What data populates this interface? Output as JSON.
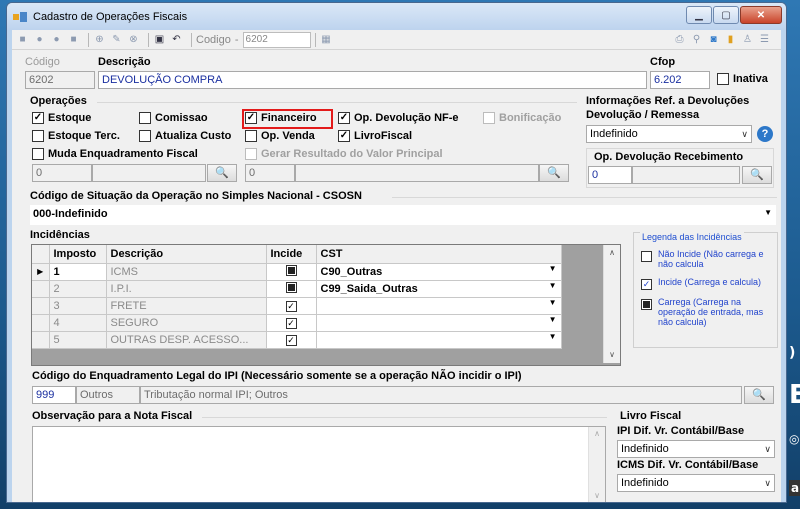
{
  "window": {
    "title": "Cadastro de Operações Fiscais"
  },
  "toolbar": {
    "codigo_label": "Codigo",
    "codigo_value": "6202"
  },
  "header": {
    "codigo_label": "Código",
    "codigo_value": "6202",
    "descricao_label": "Descrição",
    "descricao_value": "DEVOLUÇÃO COMPRA",
    "cfop_label": "Cfop",
    "cfop_value": "6.202",
    "inativa_label": "Inativa"
  },
  "operacoes": {
    "title": "Operações",
    "estoque": "Estoque",
    "comissao": "Comissao",
    "financeiro": "Financeiro",
    "op_devolucao_nfe": "Op. Devolução NF-e",
    "bonificacao": "Bonificação",
    "estoque_terc": "Estoque Terc.",
    "atualiza_custo": "Atualiza Custo",
    "op_venda": "Op. Venda",
    "livro_fiscal": "LivroFiscal",
    "muda_enquadramento": "Muda Enquadramento Fiscal",
    "gerar_resultado": "Gerar Resultado do Valor Principal",
    "muda_code": "0",
    "gerar_code": "0"
  },
  "ref_devolucoes": {
    "title1": "Informações Ref. a Devoluções",
    "title2": "Devolução / Remessa",
    "select_value": "Indefinido",
    "op_recebimento_label": "Op. Devolução Recebimento",
    "op_recebimento_value": "0"
  },
  "csosn": {
    "label": "Código de Situação da Operação no Simples Nacional - CSOSN",
    "value": "000-Indefinido"
  },
  "incidencias": {
    "title": "Incidências",
    "columns": [
      "Imposto",
      "Descrição",
      "Incide",
      "CST"
    ],
    "rows": [
      {
        "imposto": "1",
        "descricao": "ICMS",
        "cst": "C90_Outras"
      },
      {
        "imposto": "2",
        "descricao": "I.P.I.",
        "cst": "C99_Saida_Outras"
      },
      {
        "imposto": "3",
        "descricao": "FRETE",
        "cst": ""
      },
      {
        "imposto": "4",
        "descricao": "SEGURO",
        "cst": ""
      },
      {
        "imposto": "5",
        "descricao": "OUTRAS DESP. ACESSO...",
        "cst": ""
      }
    ]
  },
  "legenda": {
    "title": "Legenda das Incidências",
    "nao_incide": "Não Incide (Não carrega e não calcula",
    "incide": "Incide (Carrega e calcula)",
    "carrega": "Carrega (Carrega na operação de entrada, mas não calcula)"
  },
  "enquadramento": {
    "label": "Código do Enquadramento Legal do IPI (Necessário somente se a operação NÃO incidir o IPI)",
    "code": "999",
    "group": "Outros",
    "desc": "Tributação normal IPI; Outros"
  },
  "observacao": {
    "label": "Observação para a Nota Fiscal"
  },
  "livro_fiscal": {
    "title": "Livro Fiscal",
    "ipi_label": "IPI Dif. Vr. Contábil/Base",
    "ipi_value": "Indefinido",
    "icms_label": "ICMS Dif. Vr. Contábil/Base",
    "icms_value": "Indefinido"
  },
  "colors": {
    "accent": "#1a2fa0",
    "highlight_box": "#e31b1b",
    "legend_text": "#2244cc"
  }
}
